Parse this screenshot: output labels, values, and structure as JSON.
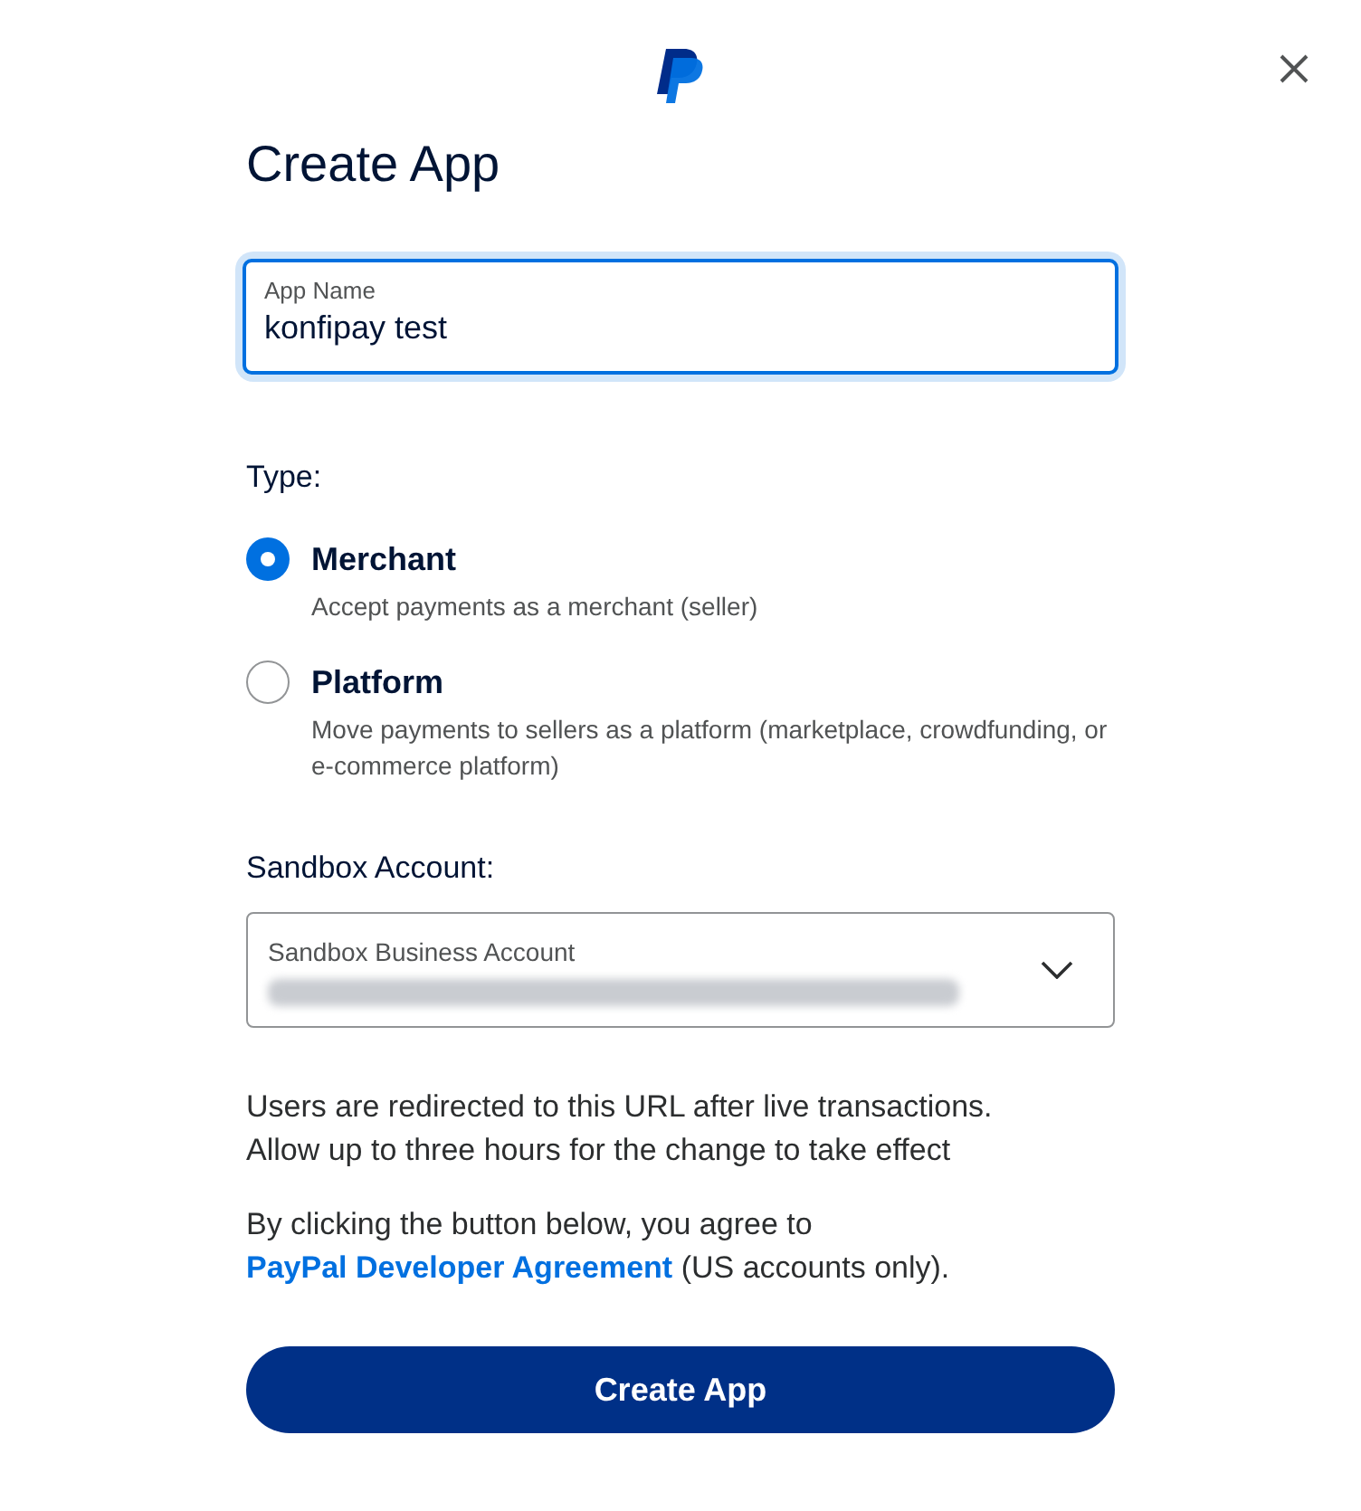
{
  "title": "Create App",
  "app_name": {
    "label": "App Name",
    "value": "konfipay test",
    "focused": true
  },
  "type": {
    "label": "Type:",
    "options": [
      {
        "label": "Merchant",
        "description": "Accept payments as a merchant (seller)",
        "selected": true
      },
      {
        "label": "Platform",
        "description": "Move payments to sellers as a platform (marketplace, crowdfunding, or e-commerce platform)",
        "selected": false
      }
    ]
  },
  "sandbox_account": {
    "label": "Sandbox Account:",
    "select_label": "Sandbox Business Account",
    "value_redacted": true
  },
  "notice": "Users are redirected to this URL after live transactions. Allow up to three hours for the change to take effect",
  "agreement": {
    "before": "By clicking the button below, you agree to ",
    "link": "PayPal Developer Agreement",
    "after": " (US accounts only)."
  },
  "button": "Create App"
}
